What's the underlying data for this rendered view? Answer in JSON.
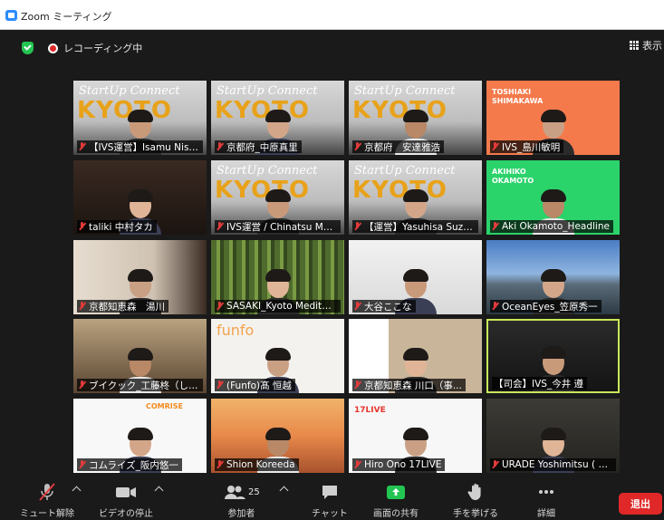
{
  "window": {
    "title": "Zoom ミーティング"
  },
  "status": {
    "recording_label": "レコーディング中"
  },
  "view": {
    "label": "表示"
  },
  "tiles": [
    {
      "name": "【IVS運営】Isamu Nishij...",
      "bg": "kyoto"
    },
    {
      "name": "京都府_中原真里",
      "bg": "kyoto"
    },
    {
      "name": "京都府　安達雅浩",
      "bg": "kyoto"
    },
    {
      "name": "IVS_島川敏明",
      "bg": "orange",
      "overlay": "TOSHIAKI\nSHIMAKAWA"
    },
    {
      "name": "taliki 中村タカ",
      "bg": "dark"
    },
    {
      "name": "IVS運営 / Chinatsu Ma...",
      "bg": "kyoto"
    },
    {
      "name": "【運営】Yasuhisa Suzuta",
      "bg": "kyoto"
    },
    {
      "name": "Aki Okamoto_Headline",
      "bg": "green",
      "overlay": "AKIHIKO\nOKAMOTO"
    },
    {
      "name": "京都知恵森　湯川",
      "bg": "room"
    },
    {
      "name": "SASAKI_Kyoto Meditati...",
      "bg": "bamboo"
    },
    {
      "name": "大谷ここな",
      "bg": "light"
    },
    {
      "name": "OceanEyes_笠原秀一",
      "bg": "mountain"
    },
    {
      "name": "ブイクック_工藤柊（しゅ...",
      "bg": "office"
    },
    {
      "name": "(Funfo)髙 恒越",
      "bg": "funfo",
      "overlay": "funfo"
    },
    {
      "name": "京都知恵森 川口（事...",
      "bg": "poster"
    },
    {
      "name": "【司会】IVS_今井 遵",
      "bg": "stage",
      "active": true
    },
    {
      "name": "コムライズ_阪内悠一",
      "bg": "comrise",
      "overlay": "COMRISE"
    },
    {
      "name": "Shion Koreeda",
      "bg": "bridge"
    },
    {
      "name": "Hiro Ono 17LIVE",
      "bg": "17live",
      "overlay": "17LIVE"
    },
    {
      "name": "URADE Yoshimitsu ( Ky...",
      "bg": "dark2"
    }
  ],
  "toolbar": {
    "mute_label": "ミュート解除",
    "video_label": "ビデオの停止",
    "participants_label": "参加者",
    "participants_count": "25",
    "chat_label": "チャット",
    "share_label": "画面の共有",
    "raise_hand_label": "手を挙げる",
    "more_label": "詳細",
    "leave_label": "退出"
  },
  "colors": {
    "share_accent": "#23c552",
    "leave": "#e02828",
    "active_border": "#c8e85a"
  }
}
